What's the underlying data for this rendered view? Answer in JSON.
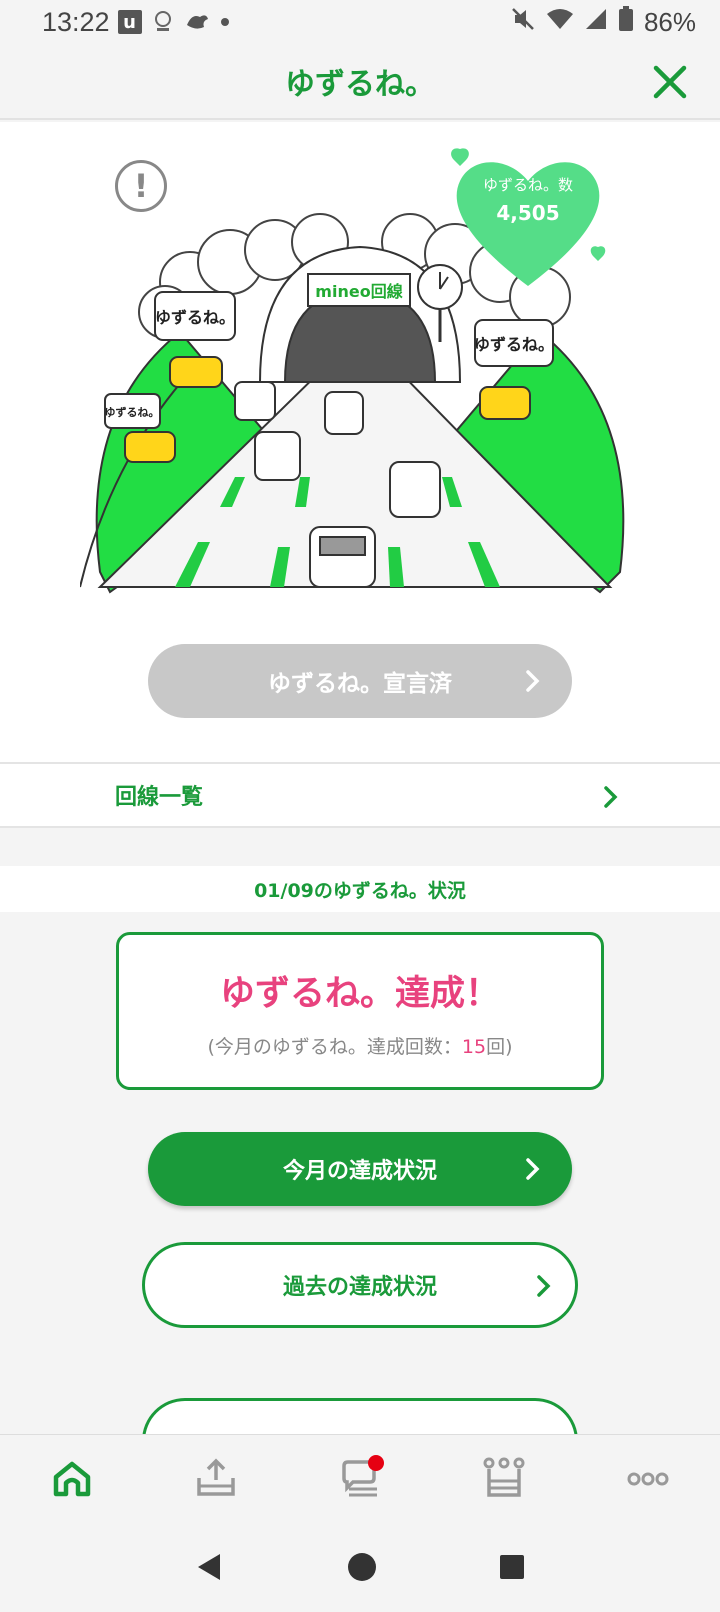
{
  "status_bar": {
    "time": "13:22",
    "battery_percent": "86%",
    "icons": [
      "u-app-icon",
      "crest-icon",
      "bird-icon",
      "dot-icon",
      "mute-icon",
      "wifi-icon",
      "signal-icon",
      "battery-icon"
    ]
  },
  "header": {
    "title": "ゆずるね。",
    "close_icon": "close-icon"
  },
  "hero": {
    "alert_icon": "exclamation-icon",
    "heart_label": "ゆずるね。数",
    "heart_count": "4,505",
    "illustration": {
      "gate_sign": "mineo回線",
      "bubble_text": "ゆずるね。"
    },
    "declare_button": "ゆずるね。宣言済"
  },
  "line_list": {
    "label": "回線一覧"
  },
  "status": {
    "heading": "01/09のゆずるね。状況",
    "result": "ゆずるね。達成！",
    "count_prefix": "(今月のゆずるね。達成回数：",
    "count_value": "15",
    "count_suffix": "回)"
  },
  "buttons": {
    "this_month": "今月の達成状況",
    "past": "過去の達成状況"
  },
  "tabbar": {
    "items": [
      {
        "icon": "home-icon",
        "active": true
      },
      {
        "icon": "upload-tray-icon",
        "active": false
      },
      {
        "icon": "chat-bubble-icon",
        "active": false,
        "badge": true
      },
      {
        "icon": "crown-icon",
        "active": false
      },
      {
        "icon": "more-dots-icon",
        "active": false
      }
    ]
  },
  "colors": {
    "brand_green": "#1a9a3a",
    "accent_pink": "#e8427e",
    "disabled_gray": "#c8c8c8",
    "badge_red": "#e60012"
  }
}
